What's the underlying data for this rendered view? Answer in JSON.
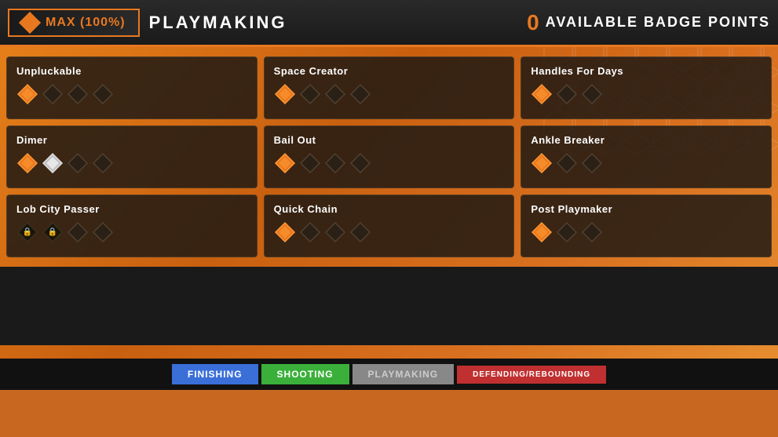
{
  "header": {
    "max_label": "MAX (100%)",
    "category_label": "PLAYMAKING",
    "badge_count": "0",
    "badge_points_label": "AVAILABLE BADGE POINTS"
  },
  "badges": [
    {
      "name": "Unpluckable",
      "row": 0,
      "col": 0,
      "icons": [
        "orange",
        "gray",
        "gray",
        "gray"
      ]
    },
    {
      "name": "Space Creator",
      "row": 0,
      "col": 1,
      "icons": [
        "orange",
        "gray",
        "gray",
        "gray"
      ]
    },
    {
      "name": "Handles For Days",
      "row": 0,
      "col": 2,
      "icons": [
        "orange",
        "gray",
        "gray"
      ]
    },
    {
      "name": "Dimer",
      "row": 1,
      "col": 0,
      "icons": [
        "orange",
        "silver",
        "gray",
        "gray"
      ]
    },
    {
      "name": "Bail Out",
      "row": 1,
      "col": 1,
      "icons": [
        "orange",
        "gray",
        "gray",
        "gray"
      ]
    },
    {
      "name": "Ankle Breaker",
      "row": 1,
      "col": 2,
      "icons": [
        "orange",
        "gray",
        "gray"
      ]
    },
    {
      "name": "Lob City Passer",
      "row": 2,
      "col": 0,
      "icons": [
        "locked",
        "locked",
        "gray",
        "gray"
      ]
    },
    {
      "name": "Quick Chain",
      "row": 2,
      "col": 1,
      "icons": [
        "orange",
        "gray",
        "gray",
        "gray"
      ]
    },
    {
      "name": "Post Playmaker",
      "row": 2,
      "col": 2,
      "icons": [
        "orange",
        "gray",
        "gray"
      ]
    }
  ],
  "nav_tabs": [
    {
      "label": "FINISHING",
      "style": "finishing",
      "active": false
    },
    {
      "label": "SHOOTING",
      "style": "shooting",
      "active": false
    },
    {
      "label": "PLAYMAKING",
      "style": "playmaking",
      "active": true
    },
    {
      "label": "DEFENDING/REBOUNDING",
      "style": "defending",
      "active": false
    }
  ]
}
